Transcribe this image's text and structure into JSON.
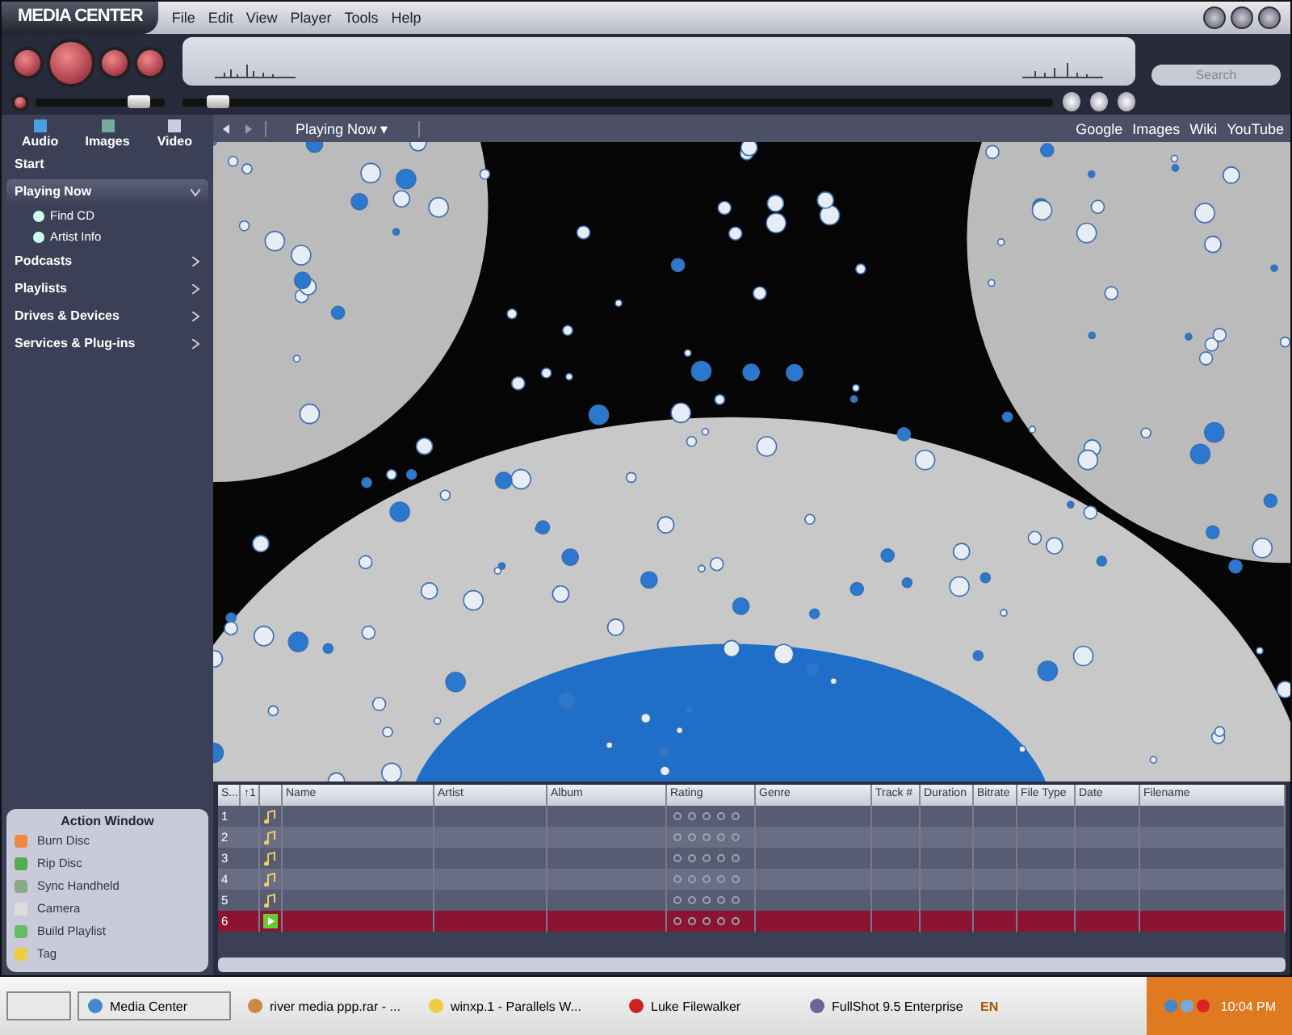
{
  "window": {
    "logo": "MEDIA CENTER",
    "menu": [
      "File",
      "Edit",
      "View",
      "Player",
      "Tools",
      "Help"
    ]
  },
  "player": {
    "volume": {
      "level": 0.8
    },
    "position": {
      "level": 0.04
    },
    "search": {
      "placeholder": "Search"
    }
  },
  "media_tabs": [
    {
      "label": "Audio",
      "selected": false
    },
    {
      "label": "Images",
      "selected": false
    },
    {
      "label": "Video",
      "selected": false
    }
  ],
  "sidebar": {
    "items": [
      {
        "label": "Start",
        "selected": false
      },
      {
        "label": "Playing Now",
        "selected": true,
        "expanded": true,
        "children": [
          {
            "label": "Find CD"
          },
          {
            "label": "Artist Info"
          }
        ]
      },
      {
        "label": "Podcasts",
        "selected": false,
        "expanded": false
      },
      {
        "label": "Playlists",
        "selected": false,
        "expanded": false
      },
      {
        "label": "Drives & Devices",
        "selected": false,
        "expanded": false
      },
      {
        "label": "Services & Plug-ins",
        "selected": false,
        "expanded": false
      }
    ]
  },
  "action_window": {
    "title": "Action Window",
    "items": [
      "Burn Disc",
      "Rip Disc",
      "Sync Handheld",
      "Camera",
      "Build Playlist",
      "Tag"
    ]
  },
  "view_tab": {
    "label": "Playing Now ▾"
  },
  "links": [
    "Google",
    "Images",
    "Wiki",
    "YouTube"
  ],
  "table": {
    "columns": [
      "S...",
      "↑1",
      "Name",
      "Artist",
      "Album",
      "Rating",
      "Genre",
      "Track #",
      "Duration",
      "Bitrate",
      "File Type",
      "Date",
      "Filename"
    ],
    "rows": [
      {
        "number": "1",
        "playing": false,
        "selected": false,
        "stars": 0
      },
      {
        "number": "2",
        "playing": false,
        "selected": false,
        "stars": 0
      },
      {
        "number": "3",
        "playing": false,
        "selected": false,
        "stars": 0
      },
      {
        "number": "4",
        "playing": false,
        "selected": false,
        "stars": 0
      },
      {
        "number": "5",
        "playing": false,
        "selected": false,
        "stars": 0
      },
      {
        "number": "6",
        "playing": true,
        "selected": true,
        "stars": 0
      }
    ]
  },
  "taskbar": {
    "tasks": [
      {
        "label": "Media Center",
        "selected": true
      },
      {
        "label": "river media ppp.rar - ...",
        "selected": false
      },
      {
        "label": "winxp.1 - Parallels W...",
        "selected": false
      },
      {
        "label": "Luke Filewalker",
        "selected": false
      },
      {
        "label": "FullShot 9.5 Enterprise",
        "selected": false
      }
    ],
    "language": "EN",
    "time": "10:04 PM"
  }
}
